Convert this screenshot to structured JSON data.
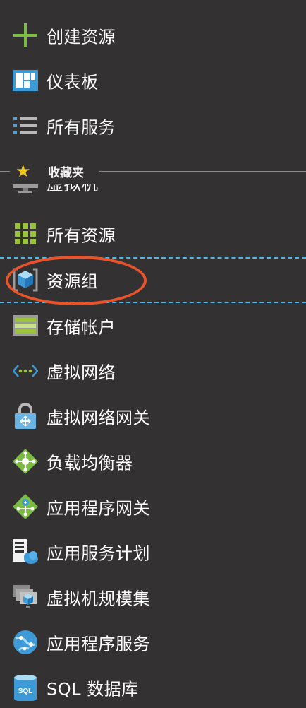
{
  "menu": {
    "create": "创建资源",
    "dashboard": "仪表板",
    "all_services": "所有服务"
  },
  "favorites": {
    "label": "收藏夹",
    "partial_item": "虚拟机",
    "items": [
      {
        "label": "所有资源",
        "icon": "grid-icon"
      },
      {
        "label": "资源组",
        "icon": "cube-icon"
      },
      {
        "label": "存储帐户",
        "icon": "storage-icon"
      },
      {
        "label": "虚拟网络",
        "icon": "vnet-icon"
      },
      {
        "label": "虚拟网络网关",
        "icon": "lock-icon"
      },
      {
        "label": "负载均衡器",
        "icon": "diamond-icon"
      },
      {
        "label": "应用程序网关",
        "icon": "diamond-icon"
      },
      {
        "label": "应用服务计划",
        "icon": "server-cloud-icon"
      },
      {
        "label": "虚拟机规模集",
        "icon": "vmss-icon"
      },
      {
        "label": "应用程序服务",
        "icon": "globe-icon"
      },
      {
        "label": "SQL 数据库",
        "icon": "database-icon"
      }
    ]
  },
  "icons": {
    "sql_badge": "SQL"
  },
  "colors": {
    "background": "#333131",
    "plus_green": "#7bbd43",
    "accent_blue": "#3e9ad6",
    "star_yellow": "#f2c811",
    "highlight_dash": "#4fb8e6",
    "annotation_red": "#e8532b"
  }
}
